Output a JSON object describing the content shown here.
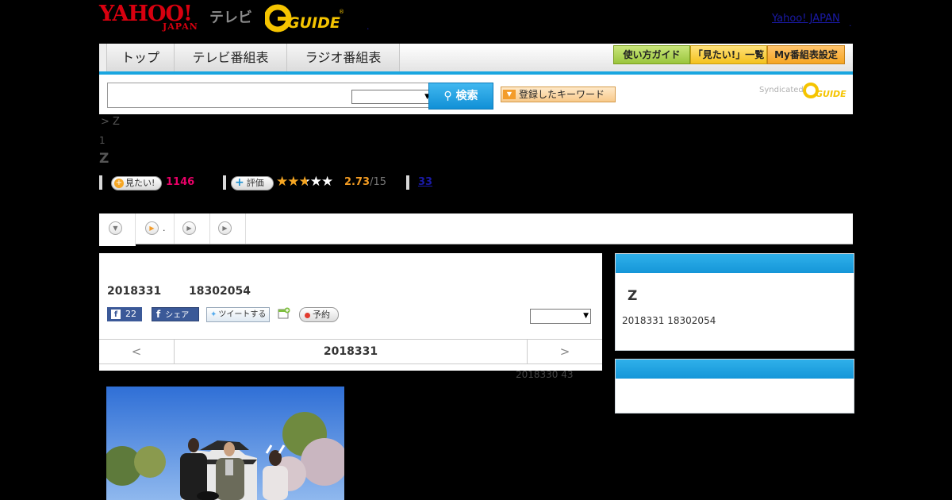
{
  "header": {
    "logo_yahoo": "YAHOO!",
    "logo_japan": "JAPAN",
    "logo_tv": "テレビ",
    "logo_gguide": "G GUIDE",
    "yahoo_japan_link": "Yahoo! JAPAN",
    "dot": "."
  },
  "nav": {
    "tabs": [
      "トップ",
      "テレビ番組表",
      "ラジオ番組表"
    ],
    "right_buttons": [
      "使い方ガイド",
      "「見たい!」一覧",
      "My番組表設定"
    ]
  },
  "search": {
    "input_value": "",
    "select_value": "",
    "search_label": "検索",
    "keyword_label": "登録したキーワード",
    "syndicated": "Syndicated",
    "gguide": "G GUIDE"
  },
  "program": {
    "breadcrumb": "> Z",
    "count": "1",
    "title": "Z",
    "mitai_label": "見たい!",
    "mitai_count": "1146",
    "rating_label": "評価",
    "rating_value": "2.73",
    "rating_max": "/15",
    "rating_stars": 2.73,
    "reviews_count": "33"
  },
  "tabs_strip": {
    "items": [
      "",
      ".",
      "",
      ""
    ]
  },
  "main": {
    "date": "2018331",
    "time": "18302054",
    "fb_count": "22",
    "fb_share": "シェア",
    "tweet": "ツイートする",
    "reserve": "予約",
    "select_value": "",
    "prev": "<",
    "next": ">",
    "current_date": "2018331",
    "below_date": "2018330  43"
  },
  "sidebar": {
    "box1": {
      "title": "Z",
      "date_time": "2018331  18302054"
    },
    "box2": {}
  },
  "colors": {
    "accent_blue": "#1aa6e0",
    "yahoo_red": "#d8000f",
    "mitai_pink": "#e60066",
    "rating_orange": "#f29b22",
    "nav_green": "#9bc53d",
    "nav_orange": "#f6a623"
  },
  "icons": {
    "search": "search-icon",
    "keyword": "triangle-down-icon",
    "plus": "plus-icon",
    "facebook": "facebook-icon",
    "twitter": "twitter-bird-icon",
    "reserve": "record-dot-icon"
  }
}
